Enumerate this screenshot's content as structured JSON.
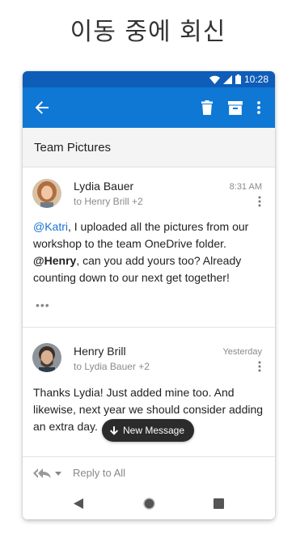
{
  "headline": "이동 중에 회신",
  "status": {
    "time": "10:28"
  },
  "conversation": {
    "subject": "Team Pictures"
  },
  "messages": [
    {
      "sender": "Lydia Bauer",
      "recipients": "to Henry Brill +2",
      "time": "8:31 AM",
      "body": {
        "mention1": "@Katri",
        "text1": ", I uploaded all the pictures from our workshop to the team OneDrive folder. ",
        "mention2": "@Henry",
        "text2": ", can you add yours too? Already counting down to our next get together!"
      },
      "ellipsis": "•••"
    },
    {
      "sender": "Henry Brill",
      "recipients": "to Lydia Bauer +2",
      "time": "Yesterday",
      "body": "Thanks Lydia! Just added mine too. And likewise, next year we should consider adding an extra day."
    }
  ],
  "toast": {
    "label": "New Message"
  },
  "reply": {
    "label": "Reply to All"
  },
  "colors": {
    "statusbar": "#0e5db8",
    "appbar": "#0f78d4",
    "mention": "#1a73d1"
  }
}
